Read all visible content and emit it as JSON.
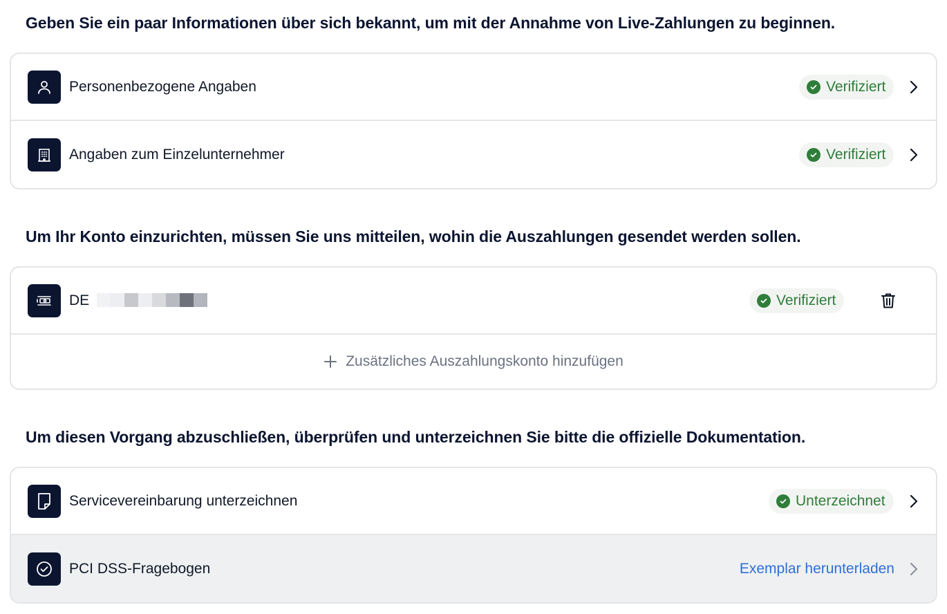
{
  "section1": {
    "heading": "Geben Sie ein paar Informationen über sich bekannt, um mit der Annahme von Live-Zahlungen zu beginnen.",
    "rows": [
      {
        "icon": "person-icon",
        "label": "Personenbezogene Angaben",
        "status": "Verifiziert"
      },
      {
        "icon": "building-icon",
        "label": "Angaben zum Einzelunternehmer",
        "status": "Verifiziert"
      }
    ]
  },
  "section2": {
    "heading": "Um Ihr Konto einzurichten, müssen Sie uns mitteilen, wohin die Auszahlungen gesendet werden sollen.",
    "account": {
      "icon": "bank-account-icon",
      "label": "DE",
      "status": "Verifiziert"
    },
    "add_label": "Zusätzliches Auszahlungskonto hinzufügen"
  },
  "section3": {
    "heading": "Um diesen Vorgang abzuschließen, überprüfen und unterzeichnen Sie bitte die offizielle Dokumentation.",
    "rows": [
      {
        "icon": "document-icon",
        "label": "Servicevereinbarung unterzeichnen",
        "status": "Unterzeichnet"
      },
      {
        "icon": "check-circle-icon",
        "label": "PCI DSS-Fragebogen",
        "link": "Exemplar herunterladen"
      }
    ]
  },
  "colors": {
    "verified_green": "#2f7d3a",
    "link_blue": "#2f6fd6",
    "icon_bg": "#0b1530"
  }
}
